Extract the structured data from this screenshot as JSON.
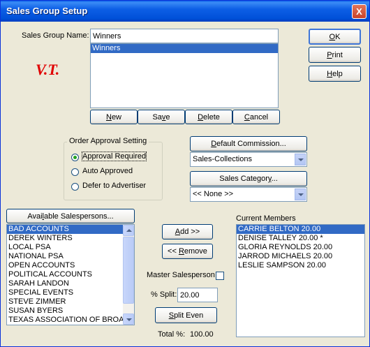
{
  "window": {
    "title": "Sales Group Setup",
    "close_label": "X"
  },
  "group_name": {
    "label": "Sales Group Name:",
    "value": "Winners"
  },
  "group_list": [
    "Winners"
  ],
  "stamp_text": "V.T.",
  "buttons": {
    "ok": "OK",
    "print": "Print",
    "help": "Help",
    "new": "New",
    "save": "Save",
    "delete": "Delete",
    "cancel": "Cancel",
    "default_commission": "Default Commission...",
    "sales_category": "Sales Category...",
    "available_salespersons": "Available Salespersons...",
    "add": "Add >>",
    "remove": "<< Remove",
    "split_even": "Split Even"
  },
  "order_approval": {
    "title": "Order Approval Setting",
    "options": [
      "Approval Required",
      "Auto Approved",
      "Defer to Advertiser"
    ],
    "selected": 0
  },
  "commission_combo": "Sales-Collections",
  "category_combo": "<< None >>",
  "available": [
    "BAD ACCOUNTS",
    "DEREK WINTERS",
    "LOCAL PSA",
    "NATIONAL PSA",
    "OPEN ACCOUNTS",
    "POLITICAL ACCOUNTS",
    "SARAH LANDON",
    "SPECIAL EVENTS",
    "STEVE ZIMMER",
    "SUSAN BYERS",
    "TEXAS ASSOCIATION OF BROADCASTERS"
  ],
  "current_members_label": "Current Members",
  "members": [
    "CARRIE BELTON 20.00",
    "DENISE TALLEY 20.00 *",
    "GLORIA REYNOLDS 20.00",
    "JARROD MICHAELS 20.00",
    "LESLIE SAMPSON 20.00"
  ],
  "master_salesperson_label": "Master Salesperson",
  "split": {
    "label": "% Split:",
    "value": "20.00"
  },
  "total": {
    "label": "Total %:",
    "value": "100.00"
  }
}
